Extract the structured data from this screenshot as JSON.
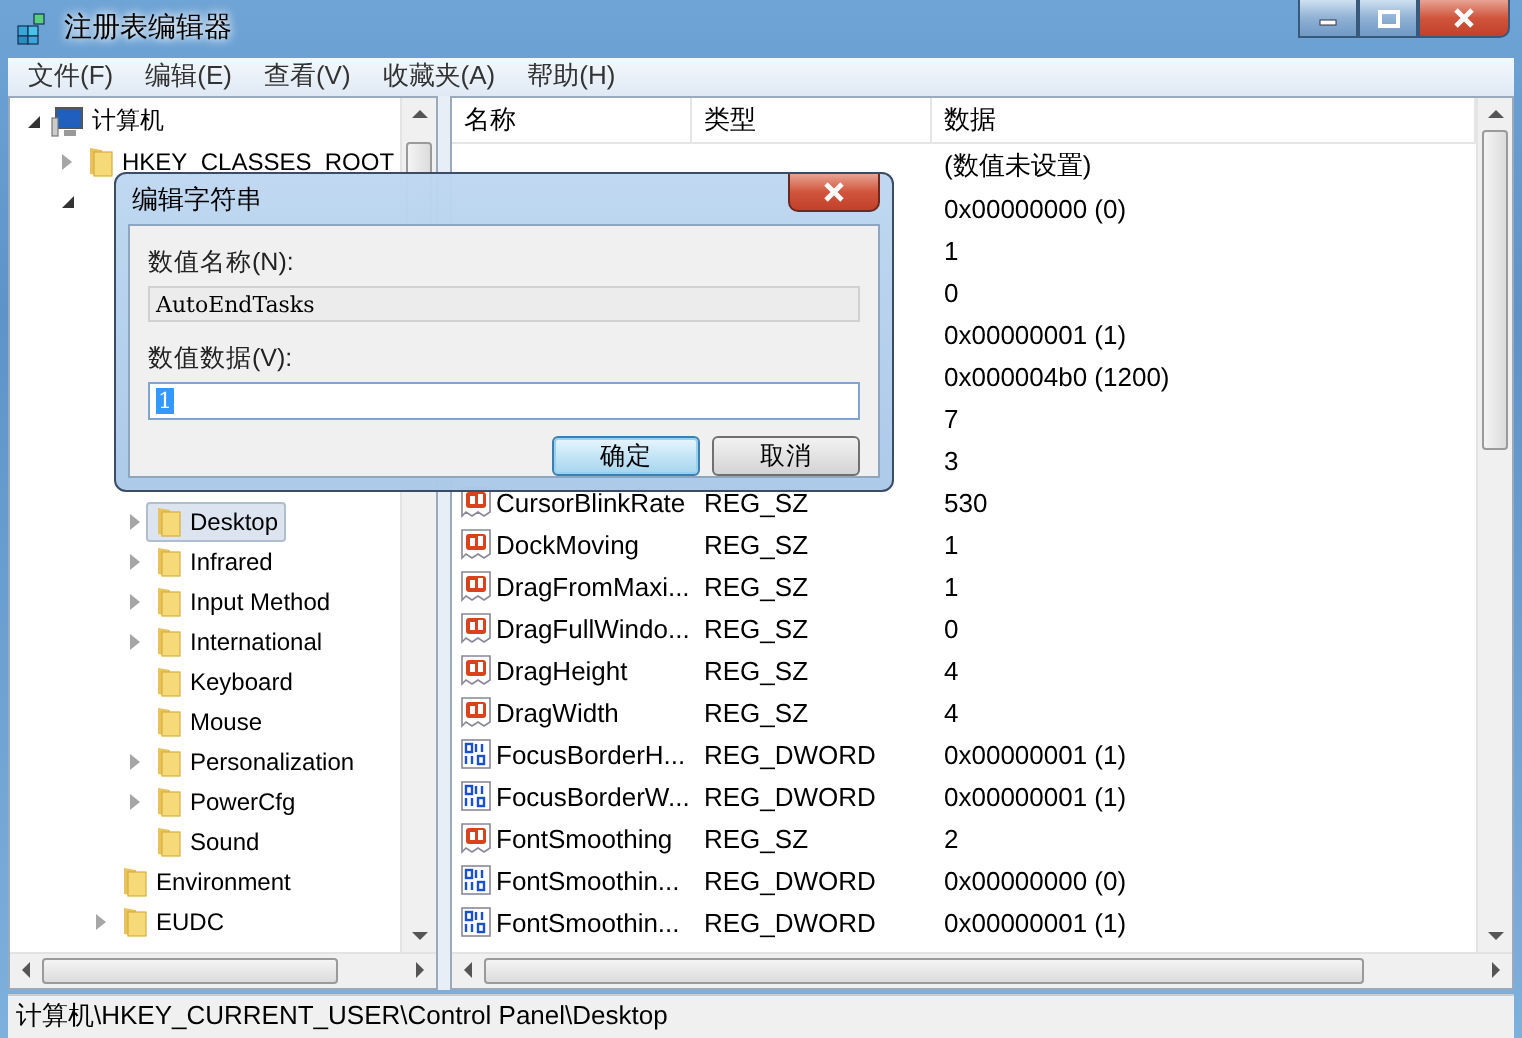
{
  "window": {
    "title": "注册表编辑器"
  },
  "menu": [
    "文件(F)",
    "编辑(E)",
    "查看(V)",
    "收藏夹(A)",
    "帮助(H)"
  ],
  "tree": {
    "label": "计算机",
    "kind": "computer",
    "expanded": true,
    "selected": false,
    "children": [
      {
        "label": "HKEY_CLASSES_ROOT",
        "kind": "folder",
        "expanded": false,
        "selected": false
      },
      {
        "expanded": true,
        "children": [
          {
            "children": [
              {
                "label": "Desktop",
                "kind": "folder",
                "expanded": false,
                "selected": true
              },
              {
                "label": "Infrared",
                "kind": "folder",
                "expanded": false,
                "selected": false
              },
              {
                "label": "Input Method",
                "kind": "folder",
                "expanded": false,
                "selected": false
              },
              {
                "label": "International",
                "kind": "folder",
                "expanded": false,
                "selected": false
              },
              {
                "label": "Keyboard",
                "kind": "folder",
                "selected": false
              },
              {
                "label": "Mouse",
                "kind": "folder",
                "selected": false
              },
              {
                "label": "Personalization",
                "kind": "folder",
                "expanded": false,
                "selected": false
              },
              {
                "label": "PowerCfg",
                "kind": "folder",
                "expanded": false,
                "selected": false
              },
              {
                "label": "Sound",
                "kind": "folder",
                "selected": false
              }
            ]
          },
          {
            "label": "Environment",
            "kind": "folder",
            "selected": false
          },
          {
            "label": "EUDC",
            "kind": "folder",
            "expanded": false,
            "selected": false
          }
        ]
      }
    ]
  },
  "table": {
    "columns": [
      "名称",
      "类型",
      "数据"
    ],
    "rows": [
      {
        "data": "(数值未设置)"
      },
      {
        "data": "0x00000000 (0)"
      },
      {
        "data": "1"
      },
      {
        "data": "0"
      },
      {
        "data": "0x00000001 (1)"
      },
      {
        "data": "0x000004b0 (1200)"
      },
      {
        "data": "7"
      },
      {
        "data": "3"
      },
      {
        "kind": "sz",
        "name": "CursorBlinkRate",
        "type": "REG_SZ",
        "data": "530"
      },
      {
        "kind": "sz",
        "name": "DockMoving",
        "type": "REG_SZ",
        "data": "1"
      },
      {
        "kind": "sz",
        "name": "DragFromMaxi...",
        "type": "REG_SZ",
        "data": "1"
      },
      {
        "kind": "sz",
        "name": "DragFullWindo...",
        "type": "REG_SZ",
        "data": "0"
      },
      {
        "kind": "sz",
        "name": "DragHeight",
        "type": "REG_SZ",
        "data": "4"
      },
      {
        "kind": "sz",
        "name": "DragWidth",
        "type": "REG_SZ",
        "data": "4"
      },
      {
        "kind": "dword",
        "name": "FocusBorderH...",
        "type": "REG_DWORD",
        "data": "0x00000001 (1)"
      },
      {
        "kind": "dword",
        "name": "FocusBorderW...",
        "type": "REG_DWORD",
        "data": "0x00000001 (1)"
      },
      {
        "kind": "sz",
        "name": "FontSmoothing",
        "type": "REG_SZ",
        "data": "2"
      },
      {
        "kind": "dword",
        "name": "FontSmoothin...",
        "type": "REG_DWORD",
        "data": "0x00000000 (0)"
      },
      {
        "kind": "dword",
        "name": "FontSmoothin...",
        "type": "REG_DWORD",
        "data": "0x00000001 (1)"
      }
    ]
  },
  "status_bar": "计算机\\HKEY_CURRENT_USER\\Control Panel\\Desktop",
  "dialog": {
    "title": "编辑字符串",
    "name_label": "数值名称(N):",
    "name_value": "AutoEndTasks",
    "data_label": "数值数据(V):",
    "data_value": "1",
    "buttons": [
      {
        "label": "确定",
        "default": true
      },
      {
        "label": "取消",
        "default": false
      }
    ]
  }
}
